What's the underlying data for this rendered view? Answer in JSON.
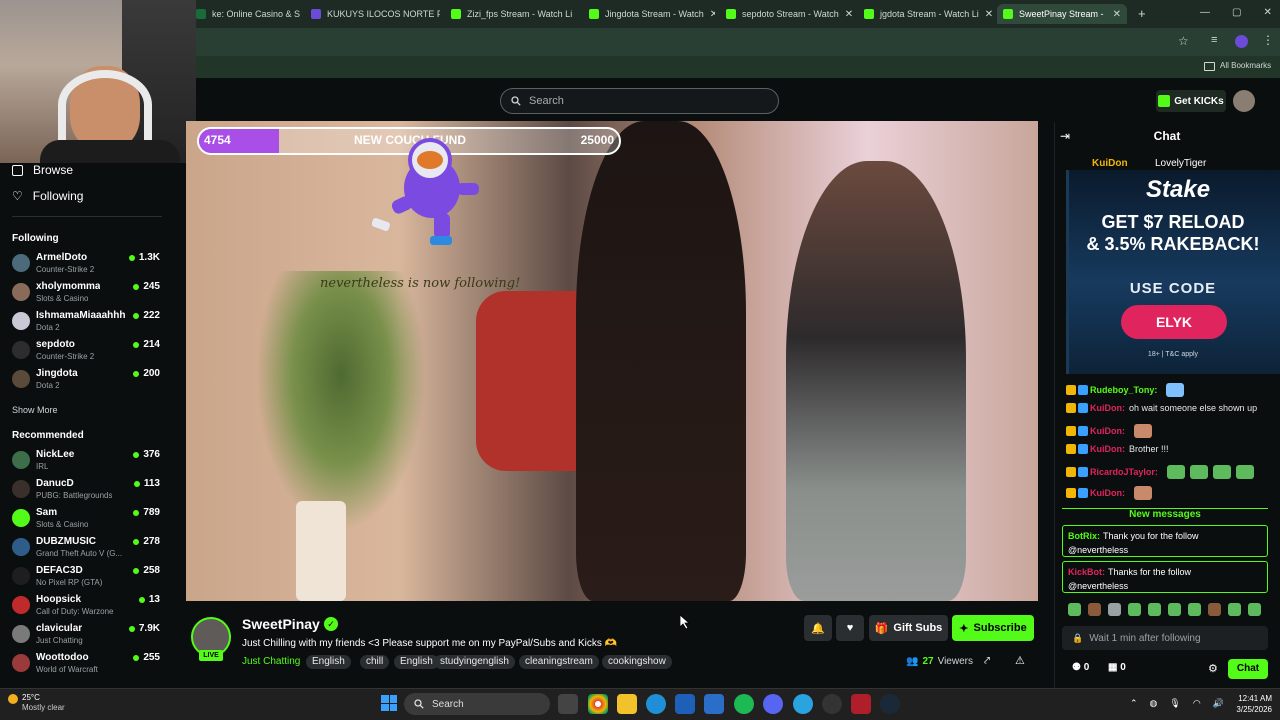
{
  "browser": {
    "tabs": [
      {
        "label": "ke: Online Casino & Sp",
        "color": "#1a6b3a"
      },
      {
        "label": "KUKUYS ILOCOS NORTE F",
        "color": "#6c4bd8"
      },
      {
        "label": "Zizi_fps Stream - Watch Li",
        "color": "#53fc18"
      },
      {
        "label": "Jingdota Stream - Watch",
        "color": "#53fc18"
      },
      {
        "label": "sepdoto Stream - Watch",
        "color": "#53fc18"
      },
      {
        "label": "jgdota Stream - Watch Li",
        "color": "#53fc18"
      },
      {
        "label": "SweetPinay Stream -",
        "color": "#53fc18"
      }
    ],
    "all_bookmarks": "All Bookmarks",
    "new_tab": "+"
  },
  "topnav": {
    "search_placeholder": "Search",
    "get_kicks": "Get KICKs"
  },
  "sidebar": {
    "browse": "Browse",
    "following_nav": "Following",
    "following_title": "Following",
    "following": [
      {
        "name": "ArmelDoto",
        "category": "Counter-Strike 2",
        "viewers": "1.3K",
        "color": "#4b6a7a"
      },
      {
        "name": "xholymomma",
        "category": "Slots & Casino",
        "viewers": "245",
        "color": "#8a6b5a"
      },
      {
        "name": "IshmamaMiaaahhh",
        "category": "Dota 2",
        "viewers": "222",
        "color": "#c9c9d6"
      },
      {
        "name": "sepdoto",
        "category": "Counter-Strike 2",
        "viewers": "214",
        "color": "#2d2d2d"
      },
      {
        "name": "Jingdota",
        "category": "Dota 2",
        "viewers": "200",
        "color": "#5a4a3a"
      }
    ],
    "show_more": "Show More",
    "recommended_title": "Recommended",
    "recommended": [
      {
        "name": "NickLee",
        "category": "IRL",
        "viewers": "376",
        "color": "#3c6e4a"
      },
      {
        "name": "DanucD",
        "category": "PUBG: Battlegrounds",
        "viewers": "113",
        "color": "#3a2f2a"
      },
      {
        "name": "Sam",
        "category": "Slots & Casino",
        "viewers": "789",
        "color": "#53fc18"
      },
      {
        "name": "DUBZMUSIC",
        "category": "Grand Theft Auto V (G...",
        "viewers": "278",
        "color": "#2f5d8a"
      },
      {
        "name": "DEFAC3D",
        "category": "No Pixel RP (GTA)",
        "viewers": "258",
        "color": "#1e1e1e"
      },
      {
        "name": "Hoopsick",
        "category": "Call of Duty: Warzone",
        "viewers": "13",
        "color": "#c02a2a"
      },
      {
        "name": "clavicular",
        "category": "Just Chatting",
        "viewers": "7.9K",
        "color": "#7a7a7a"
      },
      {
        "name": "Woottodoo",
        "category": "World of Warcraft",
        "viewers": "255",
        "color": "#9a3a3a"
      }
    ]
  },
  "video": {
    "goal_current": "4754",
    "goal_title": "NEW COUCH FUND",
    "goal_target": "25000",
    "goal_progress": 0.19,
    "follow_alert": "nevertheless is now following!"
  },
  "stream": {
    "streamer": "SweetPinay",
    "live": "LIVE",
    "title": "Just Chilling with my friends <3 Please support me on my PayPal/Subs and Kicks 🫶",
    "category": "Just Chatting",
    "tags": [
      "English",
      "chill",
      "English",
      "studyingenglish",
      "cleaningstream",
      "cookingshow"
    ],
    "gift_subs": "Gift Subs",
    "subscribe": "Subscribe",
    "viewers_count": "27",
    "viewers_label": "Viewers"
  },
  "chat": {
    "title": "Chat",
    "pinned_user": "KuiDon",
    "pinned_user2": "LovelyTiger",
    "ad": {
      "logo": "Stake",
      "line1": "GET $7 RELOAD",
      "line2": "& 3.5% RAKEBACK!",
      "use_code": "USE CODE",
      "code": "ELYK",
      "terms": "18+ | T&C apply"
    },
    "messages": [
      {
        "user": "Rudeboy_Tony:",
        "text": "",
        "color": "#53fc18",
        "emotes": 1
      },
      {
        "user": "KuiDon:",
        "text": "oh wait someone else shown up",
        "color": "#e0245e",
        "emotes": 0
      },
      {
        "user": "KuiDon:",
        "text": "",
        "color": "#e0245e",
        "emotes": 1
      },
      {
        "user": "KuiDon:",
        "text": "Brother !!!",
        "color": "#e0245e",
        "emotes": 0
      },
      {
        "user": "RicardoJTaylor:",
        "text": "",
        "color": "#e0245e",
        "emotes": 4
      },
      {
        "user": "KuiDon:",
        "text": "",
        "color": "#e0245e",
        "emotes": 1
      }
    ],
    "new_messages": "New messages",
    "bot_messages": [
      {
        "user": "BotRix:",
        "text": "Thank you for the follow",
        "text2": "@nevertheless",
        "color": "#53fc18"
      },
      {
        "user": "KickBot:",
        "text": "Thanks for the follow",
        "text2": "@nevertheless",
        "color": "#e0245e"
      }
    ],
    "input_placeholder": "Wait 1 min after following",
    "points_a": "0",
    "points_b": "0",
    "send": "Chat"
  },
  "taskbar": {
    "temp": "25°C",
    "weather": "Mostly clear",
    "search": "Search",
    "time": "12:41 AM",
    "date": "3/25/2026"
  }
}
